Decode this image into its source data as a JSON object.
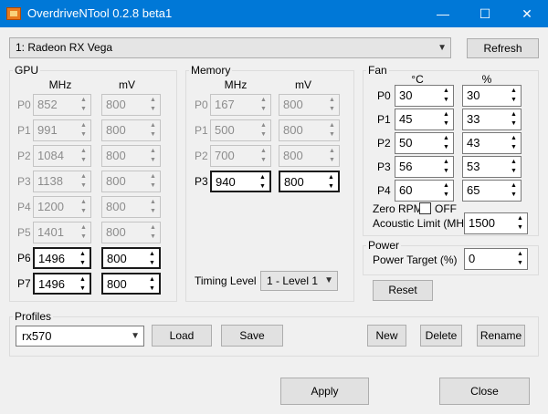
{
  "window": {
    "title": "OverdriveNTool 0.2.8 beta1",
    "minimize": "—",
    "maximize": "☐",
    "close": "✕"
  },
  "gpu_select": {
    "value": "1: Radeon RX Vega"
  },
  "refresh_label": "Refresh",
  "gpu": {
    "label": "GPU",
    "mhz_header": "MHz",
    "mv_header": "mV",
    "states": [
      {
        "label": "P0",
        "mhz": "852",
        "mv": "800"
      },
      {
        "label": "P1",
        "mhz": "991",
        "mv": "800"
      },
      {
        "label": "P2",
        "mhz": "1084",
        "mv": "800"
      },
      {
        "label": "P3",
        "mhz": "1138",
        "mv": "800"
      },
      {
        "label": "P4",
        "mhz": "1200",
        "mv": "800"
      },
      {
        "label": "P5",
        "mhz": "1401",
        "mv": "800"
      },
      {
        "label": "P6",
        "mhz": "1496",
        "mv": "800"
      },
      {
        "label": "P7",
        "mhz": "1496",
        "mv": "800"
      }
    ]
  },
  "memory": {
    "label": "Memory",
    "mhz_header": "MHz",
    "mv_header": "mV",
    "states": [
      {
        "label": "P0",
        "mhz": "167",
        "mv": "800"
      },
      {
        "label": "P1",
        "mhz": "500",
        "mv": "800"
      },
      {
        "label": "P2",
        "mhz": "700",
        "mv": "800"
      },
      {
        "label": "P3",
        "mhz": "940",
        "mv": "800"
      }
    ],
    "timing_label": "Timing Level",
    "timing_value": "1 - Level 1"
  },
  "fan": {
    "label": "Fan",
    "temp_header": "°C",
    "pct_header": "%",
    "states": [
      {
        "label": "P0",
        "temp": "30",
        "pct": "30"
      },
      {
        "label": "P1",
        "temp": "45",
        "pct": "33"
      },
      {
        "label": "P2",
        "temp": "50",
        "pct": "43"
      },
      {
        "label": "P3",
        "temp": "56",
        "pct": "53"
      },
      {
        "label": "P4",
        "temp": "60",
        "pct": "65"
      }
    ],
    "zero_rpm_label": "Zero RPM",
    "zero_rpm_state": "OFF",
    "acoustic_label": "Acoustic Limit (MHz)",
    "acoustic_value": "1500"
  },
  "power": {
    "label": "Power",
    "target_label": "Power Target (%)",
    "target_value": "0"
  },
  "reset_label": "Reset",
  "profiles": {
    "label": "Profiles",
    "selected": "rx570",
    "load": "Load",
    "save": "Save",
    "new": "New",
    "delete": "Delete",
    "rename": "Rename"
  },
  "apply_label": "Apply",
  "close_label": "Close"
}
